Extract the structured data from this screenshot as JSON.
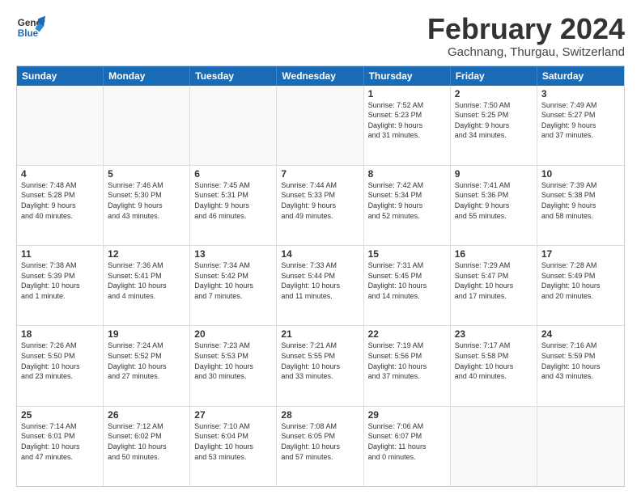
{
  "header": {
    "logo_line1": "General",
    "logo_line2": "Blue",
    "month_title": "February 2024",
    "location": "Gachnang, Thurgau, Switzerland"
  },
  "days_of_week": [
    "Sunday",
    "Monday",
    "Tuesday",
    "Wednesday",
    "Thursday",
    "Friday",
    "Saturday"
  ],
  "weeks": [
    [
      {
        "day": "",
        "empty": true
      },
      {
        "day": "",
        "empty": true
      },
      {
        "day": "",
        "empty": true
      },
      {
        "day": "",
        "empty": true
      },
      {
        "day": "1",
        "line1": "Sunrise: 7:52 AM",
        "line2": "Sunset: 5:23 PM",
        "line3": "Daylight: 9 hours",
        "line4": "and 31 minutes."
      },
      {
        "day": "2",
        "line1": "Sunrise: 7:50 AM",
        "line2": "Sunset: 5:25 PM",
        "line3": "Daylight: 9 hours",
        "line4": "and 34 minutes."
      },
      {
        "day": "3",
        "line1": "Sunrise: 7:49 AM",
        "line2": "Sunset: 5:27 PM",
        "line3": "Daylight: 9 hours",
        "line4": "and 37 minutes."
      }
    ],
    [
      {
        "day": "4",
        "line1": "Sunrise: 7:48 AM",
        "line2": "Sunset: 5:28 PM",
        "line3": "Daylight: 9 hours",
        "line4": "and 40 minutes."
      },
      {
        "day": "5",
        "line1": "Sunrise: 7:46 AM",
        "line2": "Sunset: 5:30 PM",
        "line3": "Daylight: 9 hours",
        "line4": "and 43 minutes."
      },
      {
        "day": "6",
        "line1": "Sunrise: 7:45 AM",
        "line2": "Sunset: 5:31 PM",
        "line3": "Daylight: 9 hours",
        "line4": "and 46 minutes."
      },
      {
        "day": "7",
        "line1": "Sunrise: 7:44 AM",
        "line2": "Sunset: 5:33 PM",
        "line3": "Daylight: 9 hours",
        "line4": "and 49 minutes."
      },
      {
        "day": "8",
        "line1": "Sunrise: 7:42 AM",
        "line2": "Sunset: 5:34 PM",
        "line3": "Daylight: 9 hours",
        "line4": "and 52 minutes."
      },
      {
        "day": "9",
        "line1": "Sunrise: 7:41 AM",
        "line2": "Sunset: 5:36 PM",
        "line3": "Daylight: 9 hours",
        "line4": "and 55 minutes."
      },
      {
        "day": "10",
        "line1": "Sunrise: 7:39 AM",
        "line2": "Sunset: 5:38 PM",
        "line3": "Daylight: 9 hours",
        "line4": "and 58 minutes."
      }
    ],
    [
      {
        "day": "11",
        "line1": "Sunrise: 7:38 AM",
        "line2": "Sunset: 5:39 PM",
        "line3": "Daylight: 10 hours",
        "line4": "and 1 minute."
      },
      {
        "day": "12",
        "line1": "Sunrise: 7:36 AM",
        "line2": "Sunset: 5:41 PM",
        "line3": "Daylight: 10 hours",
        "line4": "and 4 minutes."
      },
      {
        "day": "13",
        "line1": "Sunrise: 7:34 AM",
        "line2": "Sunset: 5:42 PM",
        "line3": "Daylight: 10 hours",
        "line4": "and 7 minutes."
      },
      {
        "day": "14",
        "line1": "Sunrise: 7:33 AM",
        "line2": "Sunset: 5:44 PM",
        "line3": "Daylight: 10 hours",
        "line4": "and 11 minutes."
      },
      {
        "day": "15",
        "line1": "Sunrise: 7:31 AM",
        "line2": "Sunset: 5:45 PM",
        "line3": "Daylight: 10 hours",
        "line4": "and 14 minutes."
      },
      {
        "day": "16",
        "line1": "Sunrise: 7:29 AM",
        "line2": "Sunset: 5:47 PM",
        "line3": "Daylight: 10 hours",
        "line4": "and 17 minutes."
      },
      {
        "day": "17",
        "line1": "Sunrise: 7:28 AM",
        "line2": "Sunset: 5:49 PM",
        "line3": "Daylight: 10 hours",
        "line4": "and 20 minutes."
      }
    ],
    [
      {
        "day": "18",
        "line1": "Sunrise: 7:26 AM",
        "line2": "Sunset: 5:50 PM",
        "line3": "Daylight: 10 hours",
        "line4": "and 23 minutes."
      },
      {
        "day": "19",
        "line1": "Sunrise: 7:24 AM",
        "line2": "Sunset: 5:52 PM",
        "line3": "Daylight: 10 hours",
        "line4": "and 27 minutes."
      },
      {
        "day": "20",
        "line1": "Sunrise: 7:23 AM",
        "line2": "Sunset: 5:53 PM",
        "line3": "Daylight: 10 hours",
        "line4": "and 30 minutes."
      },
      {
        "day": "21",
        "line1": "Sunrise: 7:21 AM",
        "line2": "Sunset: 5:55 PM",
        "line3": "Daylight: 10 hours",
        "line4": "and 33 minutes."
      },
      {
        "day": "22",
        "line1": "Sunrise: 7:19 AM",
        "line2": "Sunset: 5:56 PM",
        "line3": "Daylight: 10 hours",
        "line4": "and 37 minutes."
      },
      {
        "day": "23",
        "line1": "Sunrise: 7:17 AM",
        "line2": "Sunset: 5:58 PM",
        "line3": "Daylight: 10 hours",
        "line4": "and 40 minutes."
      },
      {
        "day": "24",
        "line1": "Sunrise: 7:16 AM",
        "line2": "Sunset: 5:59 PM",
        "line3": "Daylight: 10 hours",
        "line4": "and 43 minutes."
      }
    ],
    [
      {
        "day": "25",
        "line1": "Sunrise: 7:14 AM",
        "line2": "Sunset: 6:01 PM",
        "line3": "Daylight: 10 hours",
        "line4": "and 47 minutes."
      },
      {
        "day": "26",
        "line1": "Sunrise: 7:12 AM",
        "line2": "Sunset: 6:02 PM",
        "line3": "Daylight: 10 hours",
        "line4": "and 50 minutes."
      },
      {
        "day": "27",
        "line1": "Sunrise: 7:10 AM",
        "line2": "Sunset: 6:04 PM",
        "line3": "Daylight: 10 hours",
        "line4": "and 53 minutes."
      },
      {
        "day": "28",
        "line1": "Sunrise: 7:08 AM",
        "line2": "Sunset: 6:05 PM",
        "line3": "Daylight: 10 hours",
        "line4": "and 57 minutes."
      },
      {
        "day": "29",
        "line1": "Sunrise: 7:06 AM",
        "line2": "Sunset: 6:07 PM",
        "line3": "Daylight: 11 hours",
        "line4": "and 0 minutes."
      },
      {
        "day": "",
        "empty": true
      },
      {
        "day": "",
        "empty": true
      }
    ]
  ]
}
